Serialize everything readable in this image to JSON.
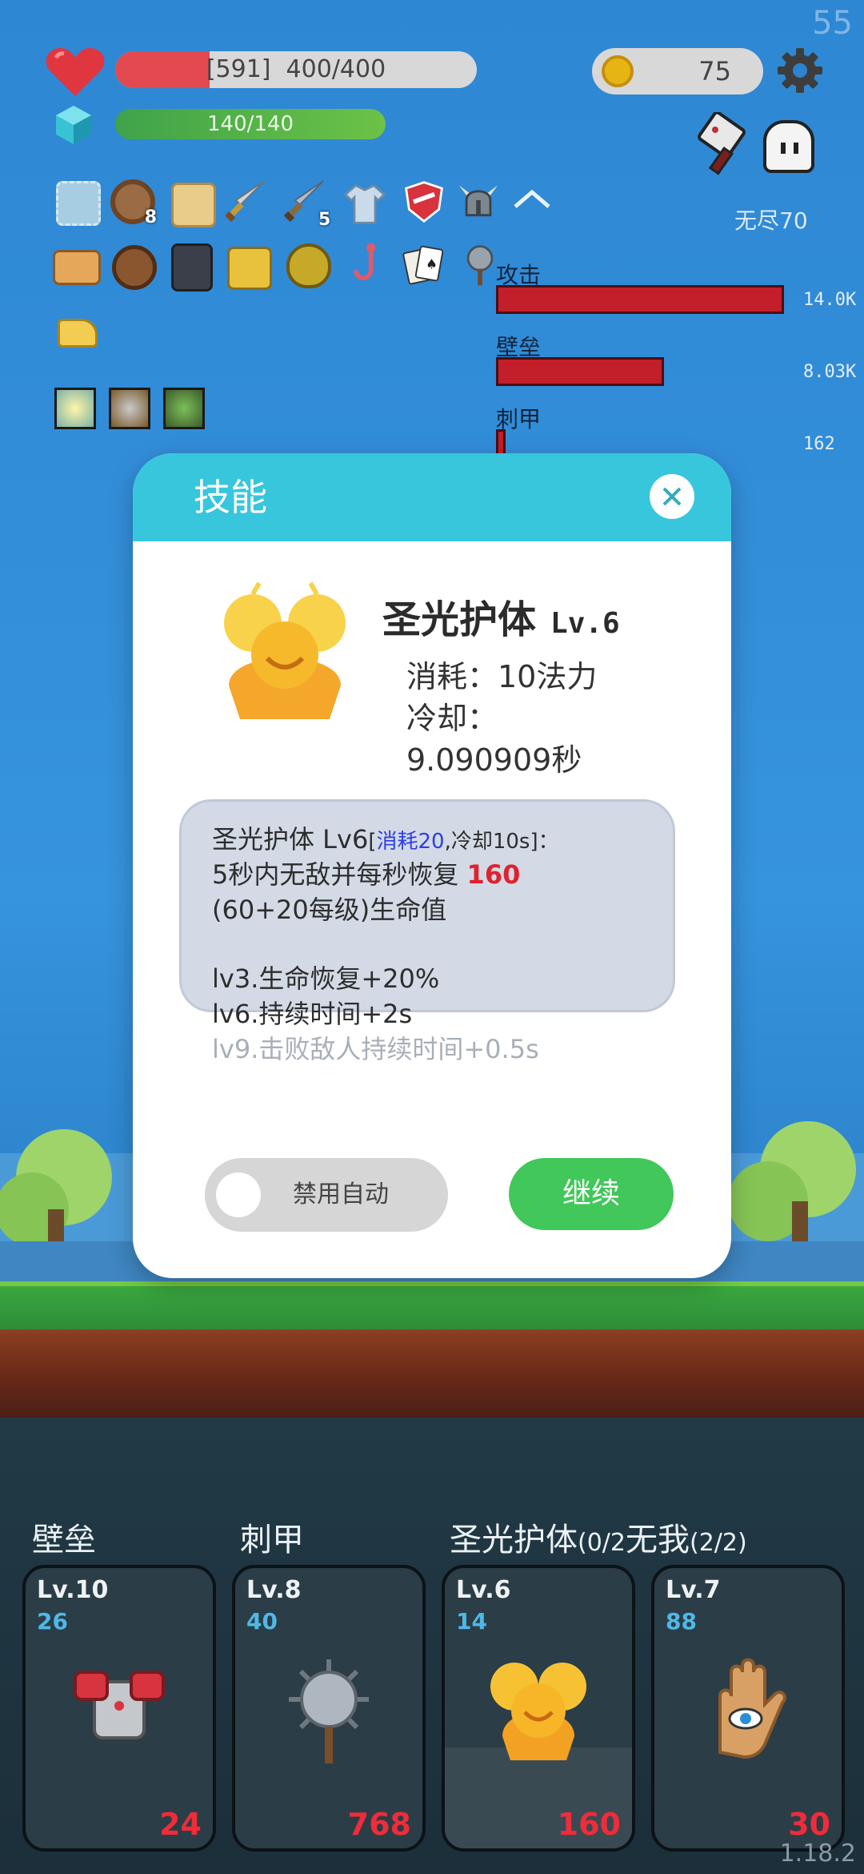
{
  "hud": {
    "fps": "55",
    "hp_text": "[591]  400/400",
    "hp_fill": 0.26,
    "mp_text": "140/140",
    "mp_fill": 1.0,
    "coins": "75",
    "mode_text": "无尽70",
    "version": "1.18.2"
  },
  "inventory": {
    "row1": [
      {
        "icon": "frame-icon",
        "count": ""
      },
      {
        "icon": "shield-round-icon",
        "count": "8"
      },
      {
        "icon": "map-icon",
        "count": ""
      },
      {
        "icon": "sword-icon",
        "count": ""
      },
      {
        "icon": "sword-icon",
        "count": "5"
      },
      {
        "icon": "shirt-icon",
        "count": ""
      },
      {
        "icon": "crest-shield-icon",
        "count": ""
      },
      {
        "icon": "viking-helmet-icon",
        "count": ""
      }
    ],
    "row2": [
      {
        "icon": "briefcase-icon",
        "count": ""
      },
      {
        "icon": "coconut-icon",
        "count": ""
      },
      {
        "icon": "skull-book-icon",
        "count": ""
      },
      {
        "icon": "battery-icon",
        "count": ""
      },
      {
        "icon": "durian-icon",
        "count": ""
      },
      {
        "icon": "hook-icon",
        "count": ""
      },
      {
        "icon": "cards-icon",
        "count": ""
      },
      {
        "icon": "mace-icon",
        "count": ""
      }
    ],
    "row3": [
      {
        "icon": "cheese-icon",
        "count": ""
      }
    ]
  },
  "stats": [
    {
      "label": "攻击",
      "value": "14.0K"
    },
    {
      "label": "壁垒",
      "value": "8.03K"
    },
    {
      "label": "刺甲",
      "value": "162"
    }
  ],
  "modal": {
    "title": "技能",
    "skill_name": "圣光护体",
    "skill_level": "Lv.6",
    "cost_line": "消耗：10法力",
    "cooldown_label": "冷却：",
    "cooldown_value": "9.090909秒",
    "desc_head": "圣光护体 Lv6",
    "desc_bracket_open": "[",
    "desc_cost": "消耗20",
    "desc_cd": ",冷却10s]：",
    "desc_line2_a": "5秒内无敌并每秒恢复 ",
    "desc_heal": "160",
    "desc_line3": "(60+20每级)生命值",
    "perk1": "lv3.生命恢复+20%",
    "perk2": "lv6.持续时间+2s",
    "perk3": "lv9.击败敌人持续时间+0.5s",
    "toggle_label": "禁用自动",
    "continue_label": "继续"
  },
  "skills_bar": {
    "titles": [
      {
        "text": "壁垒",
        "sub": ""
      },
      {
        "text": "刺甲",
        "sub": ""
      },
      {
        "text": "圣光护体",
        "sub": "(0/2"
      },
      {
        "text": "无我",
        "sub": "(2/2)"
      }
    ],
    "cards": [
      {
        "level": "Lv.10",
        "cost": "26",
        "value": "24",
        "icon": "armor-icon"
      },
      {
        "level": "Lv.8",
        "cost": "40",
        "value": "768",
        "icon": "spiked-mace-icon"
      },
      {
        "level": "Lv.6",
        "cost": "14",
        "value": "160",
        "icon": "holy-light-icon"
      },
      {
        "level": "Lv.7",
        "cost": "88",
        "value": "30",
        "icon": "eye-hand-icon"
      }
    ]
  },
  "colors": {
    "accent_header": "#38c6dd",
    "continue_green": "#42c75a",
    "hp_red": "#e24a4f",
    "stat_bar_red": "#c21f2a"
  }
}
